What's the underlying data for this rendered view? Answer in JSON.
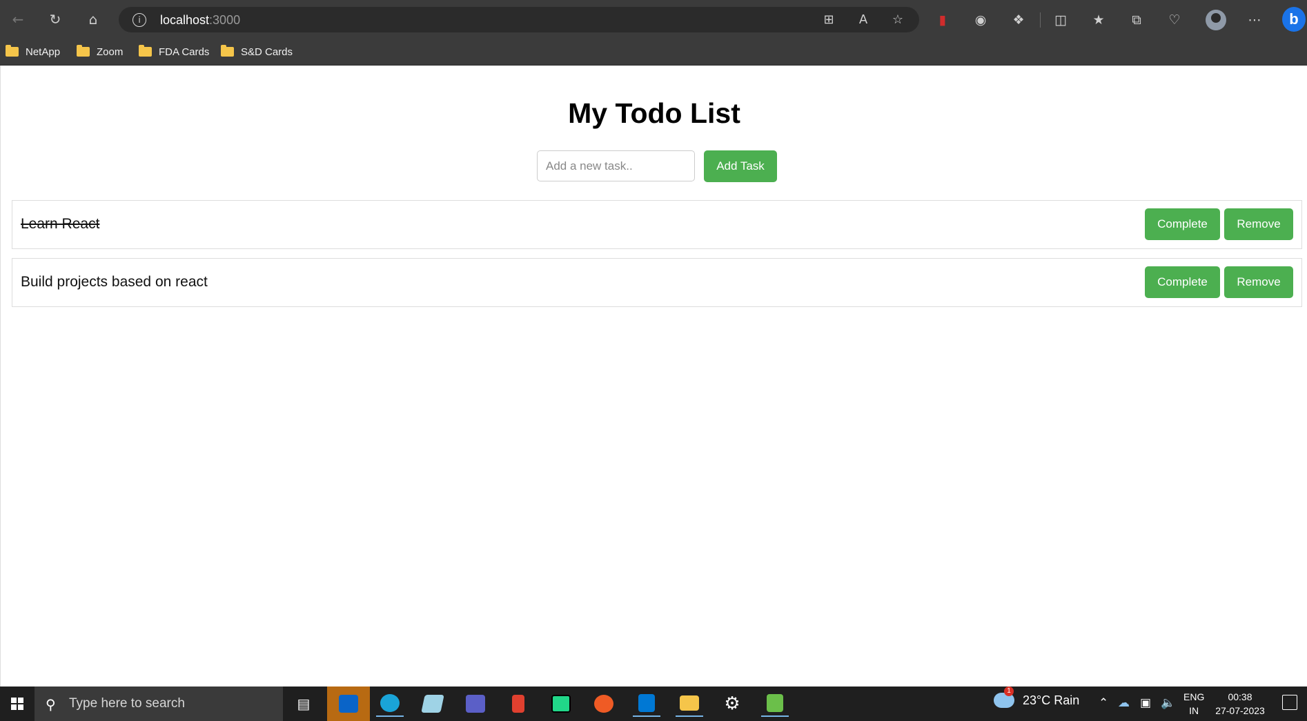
{
  "browser": {
    "url_host": "localhost",
    "url_port": ":3000",
    "bookmarks": [
      {
        "label": "NetApp"
      },
      {
        "label": "Zoom"
      },
      {
        "label": "FDA Cards"
      },
      {
        "label": "S&D Cards"
      }
    ]
  },
  "app": {
    "title": "My Todo List",
    "input_placeholder": "Add a new task..",
    "add_button": "Add Task",
    "todos": [
      {
        "text": "Learn React",
        "completed": true,
        "complete_label": "Complete",
        "remove_label": "Remove"
      },
      {
        "text": "Build projects based on react",
        "completed": false,
        "complete_label": "Complete",
        "remove_label": "Remove"
      }
    ]
  },
  "colors": {
    "button_green": "#4caf50",
    "browser_chrome": "#3b3b3b",
    "taskbar": "#1f1f1f"
  },
  "taskbar": {
    "search_placeholder": "Type here to search",
    "weather": "23°C  Rain",
    "weather_badge": "1",
    "lang_line1": "ENG",
    "lang_line2": "IN",
    "time": "00:38",
    "date": "27-07-2023"
  }
}
